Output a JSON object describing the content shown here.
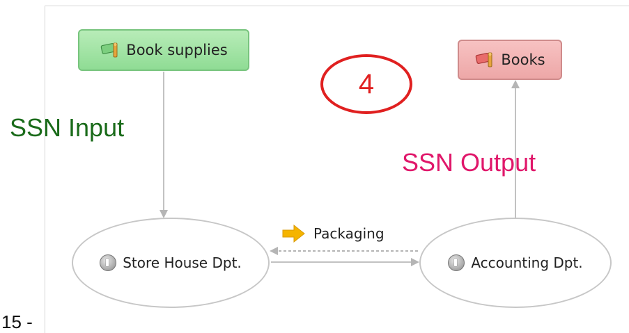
{
  "diagram": {
    "nodes": {
      "input_resource": {
        "label": "Book supplies",
        "icon": "resource-flag-icon",
        "fill": "#9fe3a3"
      },
      "output_resource": {
        "label": "Books",
        "icon": "resource-flag-icon",
        "fill": "#f2b3b3"
      },
      "left_department": {
        "label": "Store House Dpt.",
        "icon": "service-gear-icon"
      },
      "right_department": {
        "label": "Accounting Dpt.",
        "icon": "service-gear-icon"
      }
    },
    "flow": {
      "label": "Packaging",
      "icon": "arrow-right-icon",
      "icon_color": "#f5b400"
    },
    "annotations": {
      "input_label": "SSN Input",
      "input_color": "#1a6b1a",
      "output_label": "SSN Output",
      "output_color": "#e0176a",
      "step_number": "4",
      "step_color": "#e02020"
    },
    "page_number": "15 -"
  }
}
